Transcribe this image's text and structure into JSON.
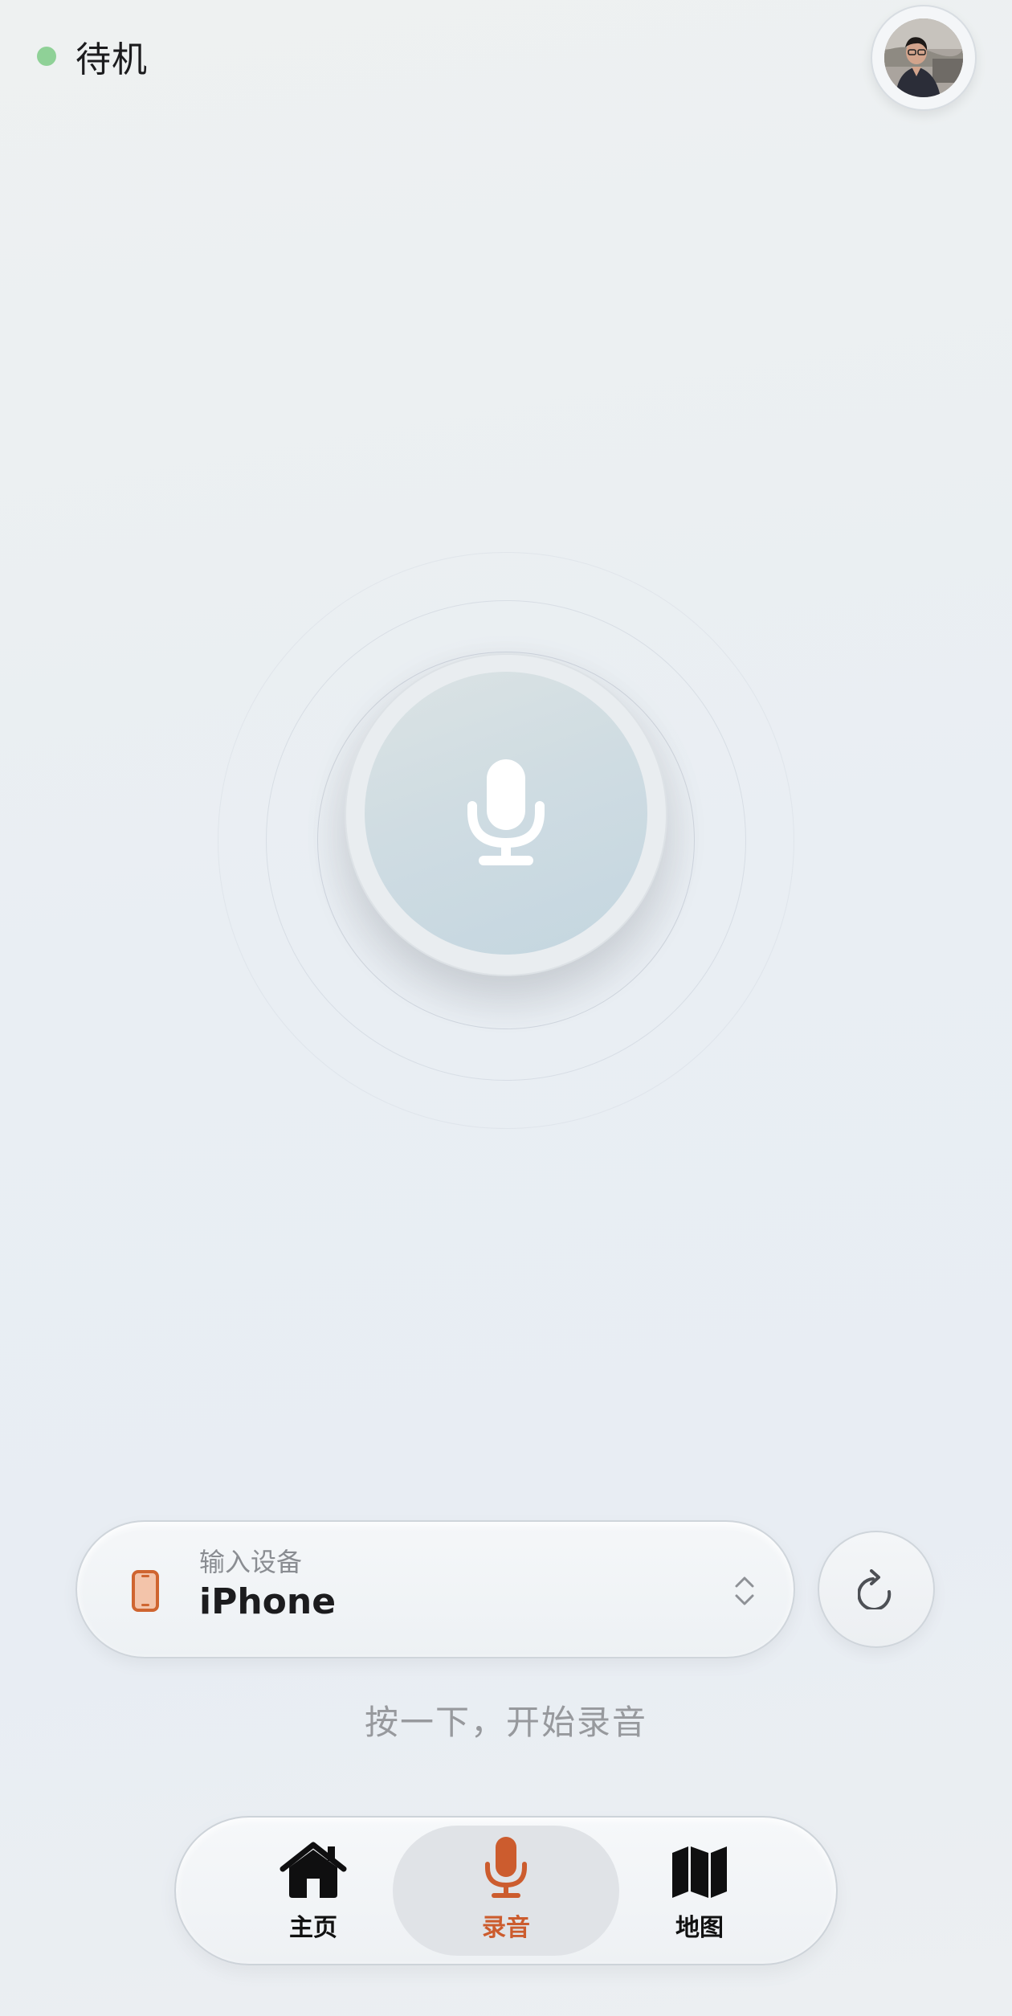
{
  "status": {
    "text": "待机",
    "dot_color": "#8fd197"
  },
  "avatar": {
    "alt": "user-avatar"
  },
  "record": {
    "icon": "microphone-icon"
  },
  "device": {
    "label": "输入设备",
    "name": "iPhone",
    "icon": "phone-icon",
    "accent_color": "#cf6530"
  },
  "refresh": {
    "icon": "refresh-icon"
  },
  "hint": "按一下，开始录音",
  "tabs": [
    {
      "label": "主页",
      "icon": "home-icon",
      "active": false
    },
    {
      "label": "录音",
      "icon": "microphone-icon",
      "active": true
    },
    {
      "label": "地图",
      "icon": "map-icon",
      "active": false
    }
  ],
  "colors": {
    "accent": "#cc5c2e",
    "active_tab_bg": "#e0e3e7"
  }
}
